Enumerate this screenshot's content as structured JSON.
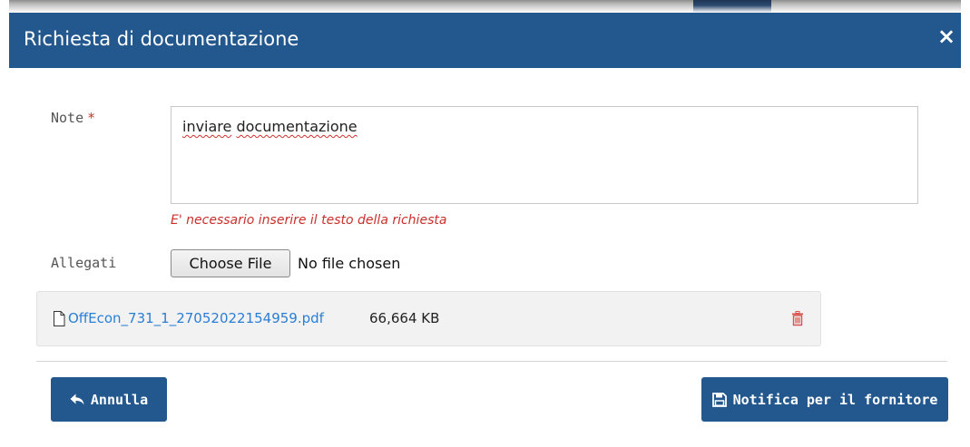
{
  "dialog": {
    "title": "Richiesta di documentazione",
    "close_label": "×"
  },
  "form": {
    "note_label": "Note",
    "required_marker": "*",
    "note_value_word1": "inviare",
    "note_value_word2": "documentazione",
    "error_message": "E' necessario inserire il testo della richiesta",
    "attachments_label": "Allegati",
    "choose_file_label": "Choose File",
    "file_status": "No file chosen"
  },
  "attachment": {
    "icon": "document-icon",
    "filename": "OffEcon_731_1_27052022154959.pdf",
    "size": "66,664 KB",
    "delete_icon": "trash-icon"
  },
  "footer": {
    "cancel_label": "Annulla",
    "cancel_icon": "reply-arrow-icon",
    "notify_label": "Notifica per il fornitore",
    "notify_icon": "floppy-disk-icon"
  },
  "colors": {
    "header_bg": "#23588f",
    "button_bg": "#23588f",
    "error": "#c9302c",
    "link": "#2a7fd4"
  }
}
